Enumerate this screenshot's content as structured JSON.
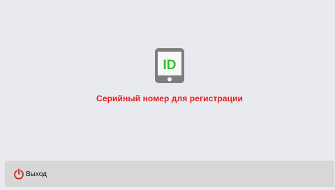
{
  "device_badge": {
    "text": "ID",
    "icon": "tablet-id-icon",
    "text_color": "#2fc12f"
  },
  "serial_label": "Серийный номер для регистрации",
  "footer": {
    "exit_label": "Выход",
    "exit_icon": "power-icon",
    "icon_color": "#cc1d1d"
  },
  "colors": {
    "background": "#e9e9f0",
    "footer_bg": "#d7d7d8",
    "label_red": "#e21d1d"
  }
}
